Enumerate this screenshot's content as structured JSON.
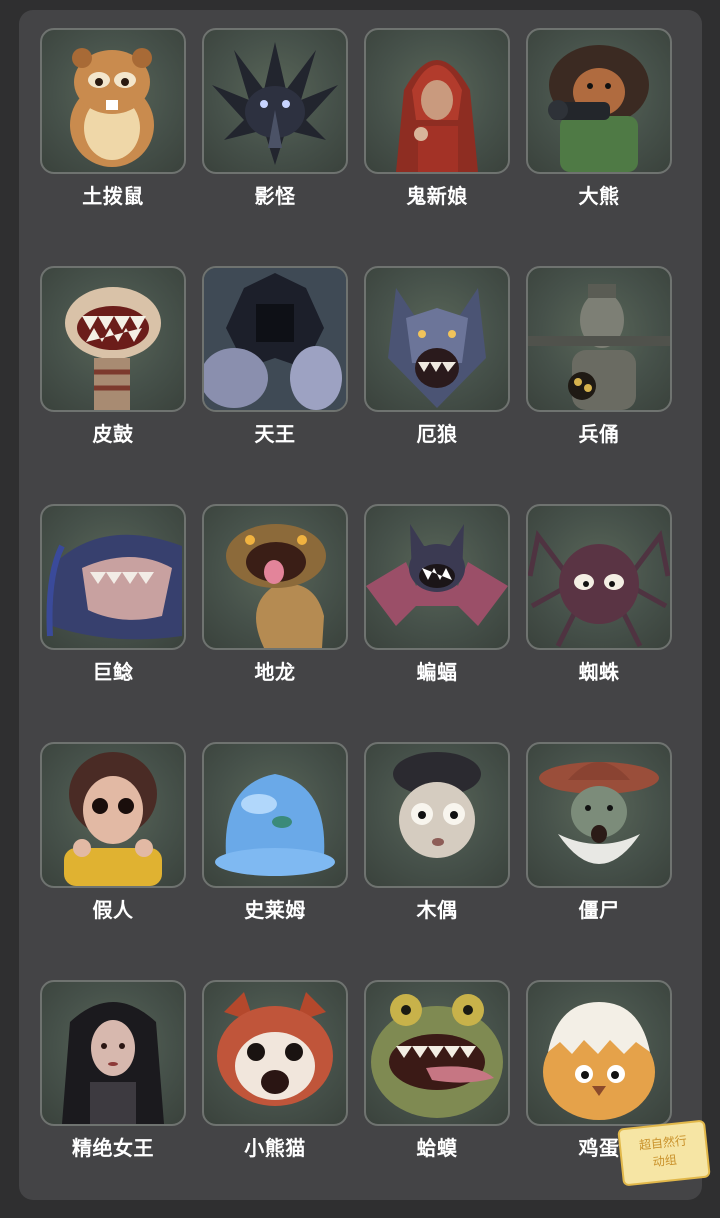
{
  "characters": [
    {
      "name": "土拨鼠",
      "icon": "hamster-icon"
    },
    {
      "name": "影怪",
      "icon": "shadow-crow-icon"
    },
    {
      "name": "鬼新娘",
      "icon": "ghost-bride-icon"
    },
    {
      "name": "大熊",
      "icon": "big-bear-icon"
    },
    {
      "name": "皮鼓",
      "icon": "skin-drum-icon"
    },
    {
      "name": "天王",
      "icon": "heavenly-king-icon"
    },
    {
      "name": "厄狼",
      "icon": "dire-wolf-icon"
    },
    {
      "name": "兵俑",
      "icon": "terracotta-soldier-icon"
    },
    {
      "name": "巨鲶",
      "icon": "giant-catfish-icon"
    },
    {
      "name": "地龙",
      "icon": "earth-dragon-icon"
    },
    {
      "name": "蝙蝠",
      "icon": "bat-icon"
    },
    {
      "name": "蜘蛛",
      "icon": "spider-icon"
    },
    {
      "name": "假人",
      "icon": "dummy-girl-icon"
    },
    {
      "name": "史莱姆",
      "icon": "slime-icon"
    },
    {
      "name": "木偶",
      "icon": "puppet-icon"
    },
    {
      "name": "僵尸",
      "icon": "zombie-icon"
    },
    {
      "name": "精绝女王",
      "icon": "jingjue-queen-icon"
    },
    {
      "name": "小熊猫",
      "icon": "red-panda-icon"
    },
    {
      "name": "蛤蟆",
      "icon": "toad-icon"
    },
    {
      "name": "鸡蛋",
      "icon": "egg-chick-icon"
    }
  ],
  "stamp": {
    "line1": "超自然行",
    "line2": "动组"
  },
  "colors": {
    "background": "#2f2f30",
    "panel": "#444446",
    "tile_border": "#6f7370",
    "label": "#ffffff"
  }
}
